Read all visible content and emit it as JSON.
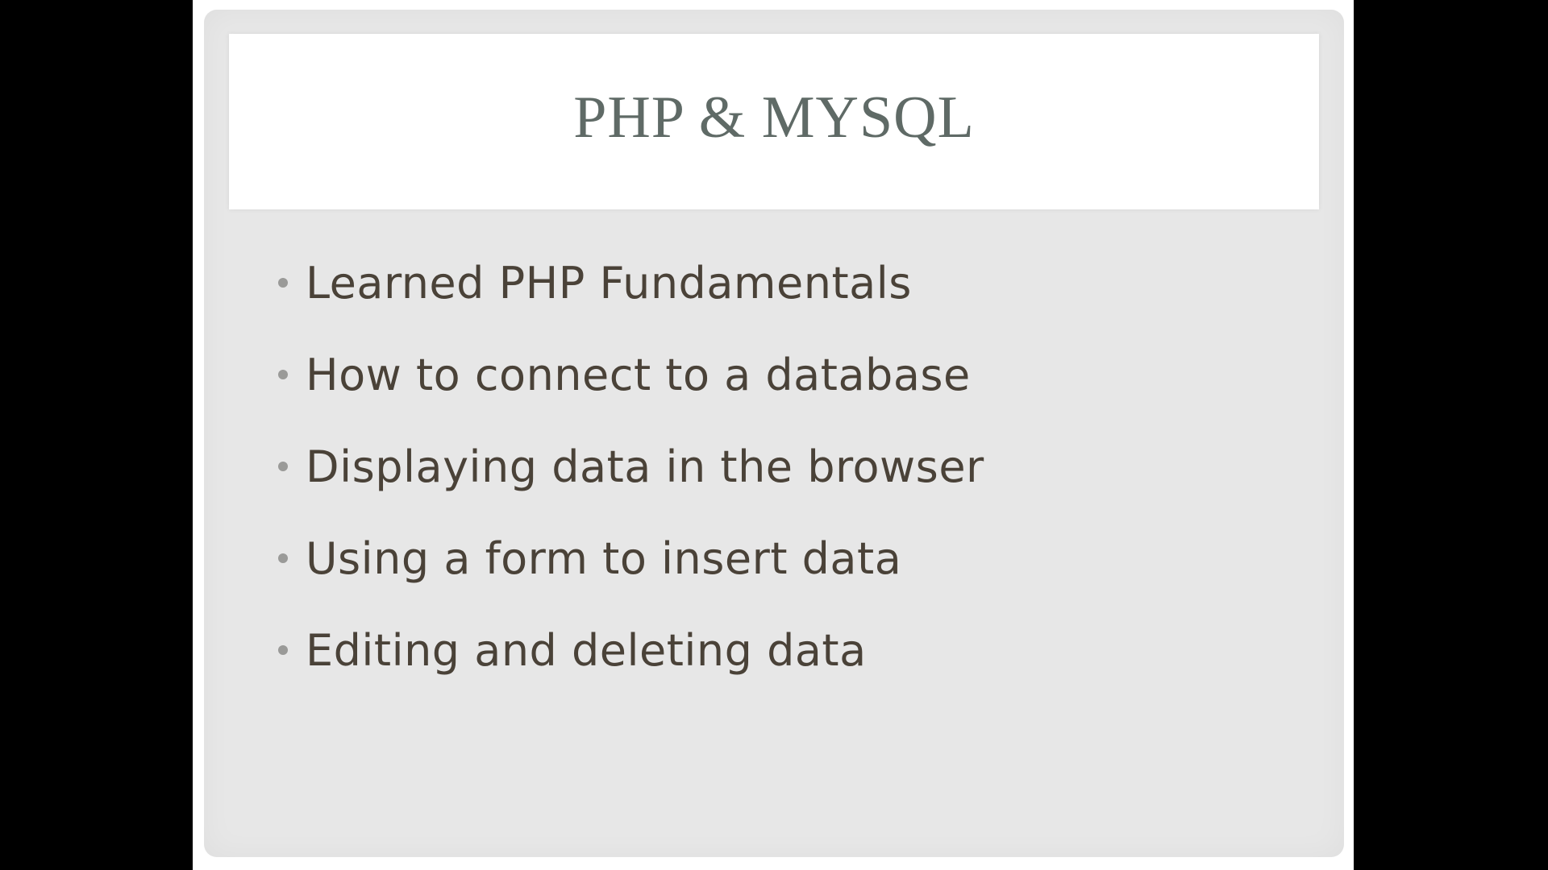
{
  "slide": {
    "title": "PHP & MYSQL",
    "bullets": [
      "Learned PHP Fundamentals",
      "How to connect to a database",
      "Displaying data in the browser",
      "Using a form to insert data",
      "Editing and deleting data"
    ]
  },
  "colors": {
    "background": "#000000",
    "slide_frame": "#e7e7e7",
    "title_box": "#ffffff",
    "title_text": "#5f6a66",
    "bullet_text": "#4a4238",
    "bullet_dot": "#9a9a98"
  }
}
